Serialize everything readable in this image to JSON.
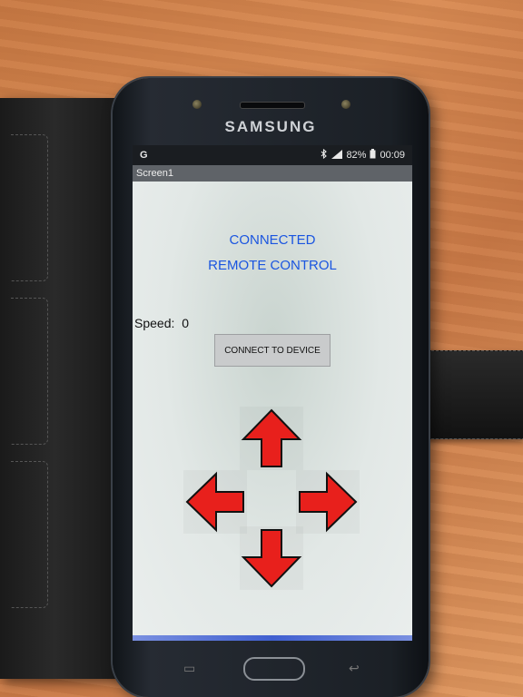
{
  "phone": {
    "brand": "SAMSUNG"
  },
  "statusbar": {
    "left_icon": "G",
    "bluetooth_icon": "bluetooth-icon",
    "signal_icon": "signal-icon",
    "battery": "82%",
    "battery_icon": "battery-icon",
    "time": "00:09"
  },
  "titlebar": {
    "title": "Screen1"
  },
  "app": {
    "status_line1": "CONNECTED",
    "status_line2": "REMOTE CONTROL",
    "speed_label": "Speed:",
    "speed_value": "0",
    "connect_button": "CONNECT TO DEVICE",
    "arrows": [
      "up",
      "left",
      "right",
      "down"
    ]
  },
  "colors": {
    "accent_text": "#1a55e0",
    "arrow_fill": "#e8201c",
    "arrow_stroke": "#111111"
  }
}
